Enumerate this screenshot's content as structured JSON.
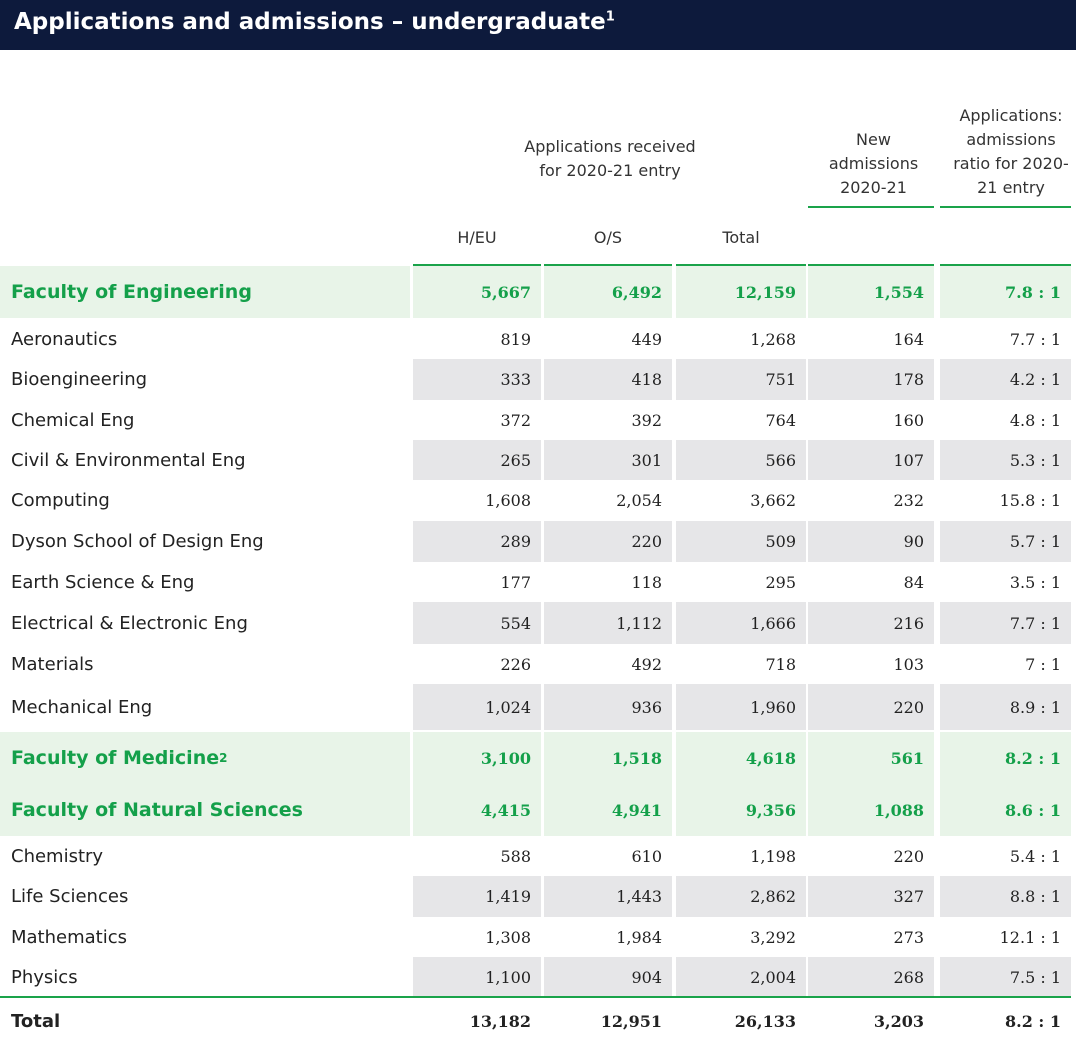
{
  "title": "Applications and admissions – undergraduate",
  "title_note": "1",
  "headers": {
    "applications_group": "Applications received for 2020-21 entry",
    "new_admissions": "New admissions 2020-21",
    "ratio": "Applications: admissions ratio for 2020-21 entry",
    "heu": "H/EU",
    "os": "O/S",
    "total": "Total"
  },
  "rows": [
    {
      "label": "Faculty of Engineering",
      "note": "",
      "heu": "5,667",
      "os": "6,492",
      "total": "12,159",
      "new": "1,554",
      "ratio": "7.8 : 1"
    },
    {
      "label": "Aeronautics",
      "heu": "819",
      "os": "449",
      "total": "1,268",
      "new": "164",
      "ratio": "7.7 : 1"
    },
    {
      "label": "Bioengineering",
      "heu": "333",
      "os": "418",
      "total": "751",
      "new": "178",
      "ratio": "4.2 : 1"
    },
    {
      "label": "Chemical Eng",
      "heu": "372",
      "os": "392",
      "total": "764",
      "new": "160",
      "ratio": "4.8 : 1"
    },
    {
      "label": "Civil & Environmental Eng",
      "heu": "265",
      "os": "301",
      "total": "566",
      "new": "107",
      "ratio": "5.3 : 1"
    },
    {
      "label": "Computing",
      "heu": "1,608",
      "os": "2,054",
      "total": "3,662",
      "new": "232",
      "ratio": "15.8 : 1"
    },
    {
      "label": "Dyson School of Design Eng",
      "heu": "289",
      "os": "220",
      "total": "509",
      "new": "90",
      "ratio": "5.7 : 1"
    },
    {
      "label": "Earth Science & Eng",
      "heu": "177",
      "os": "118",
      "total": "295",
      "new": "84",
      "ratio": "3.5 : 1"
    },
    {
      "label": "Electrical & Electronic Eng",
      "heu": "554",
      "os": "1,112",
      "total": "1,666",
      "new": "216",
      "ratio": "7.7 : 1"
    },
    {
      "label": "Materials",
      "heu": "226",
      "os": "492",
      "total": "718",
      "new": "103",
      "ratio": "7 : 1"
    },
    {
      "label": "Mechanical Eng",
      "heu": "1,024",
      "os": "936",
      "total": "1,960",
      "new": "220",
      "ratio": "8.9 : 1"
    },
    {
      "label": "Faculty of Medicine",
      "note": "2",
      "heu": "3,100",
      "os": "1,518",
      "total": "4,618",
      "new": "561",
      "ratio": "8.2 : 1"
    },
    {
      "label": "Faculty of Natural Sciences",
      "note": "",
      "heu": "4,415",
      "os": "4,941",
      "total": "9,356",
      "new": "1,088",
      "ratio": "8.6 : 1"
    },
    {
      "label": "Chemistry",
      "heu": "588",
      "os": "610",
      "total": "1,198",
      "new": "220",
      "ratio": "5.4 : 1"
    },
    {
      "label": "Life Sciences",
      "heu": "1,419",
      "os": "1,443",
      "total": "2,862",
      "new": "327",
      "ratio": "8.8 : 1"
    },
    {
      "label": "Mathematics",
      "heu": "1,308",
      "os": "1,984",
      "total": "3,292",
      "new": "273",
      "ratio": "12.1 : 1"
    },
    {
      "label": "Physics",
      "heu": "1,100",
      "os": "904",
      "total": "2,004",
      "new": "268",
      "ratio": "7.5 : 1"
    },
    {
      "label": "Total",
      "heu": "13,182",
      "os": "12,951",
      "total": "26,133",
      "new": "3,203",
      "ratio": "8.2 : 1"
    }
  ],
  "colors": {
    "title_bg": "#0d1a3c",
    "accent_green": "#1aa34a",
    "faculty_bg": "#e8f4e8",
    "zebra_grey": "#e6e6e8"
  }
}
